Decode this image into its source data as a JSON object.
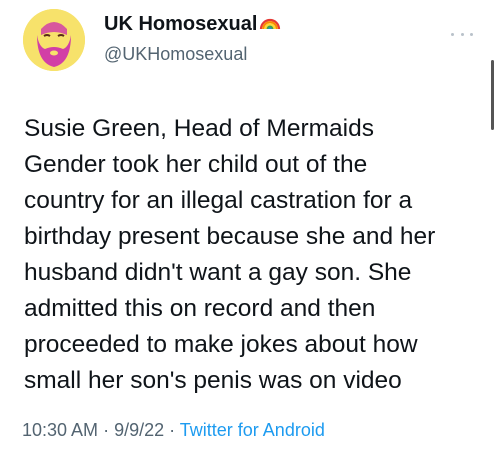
{
  "author": {
    "display_name": "UK Homosexual",
    "handle": "@UKHomosexual",
    "badge_icon": "rainbow-icon",
    "avatar_icon": "bearded-face-avatar"
  },
  "tweet": {
    "lines": [
      "Susie Green, Head of Mermaids",
      "Gender took her child out of the",
      "country for an illegal castration for a",
      "birthday present because she and her",
      "husband didn't want a gay son. She",
      "admitted this on record and then",
      "proceeded to make jokes about how",
      "small her son's penis was on video"
    ]
  },
  "meta": {
    "time": "10:30 AM",
    "separator": " · ",
    "date": "9/9/22",
    "source": "Twitter for Android"
  },
  "colors": {
    "text": "#0f1419",
    "secondary": "#536471",
    "link": "#1d9bf0",
    "avatar_bg": "#f7e26b"
  }
}
